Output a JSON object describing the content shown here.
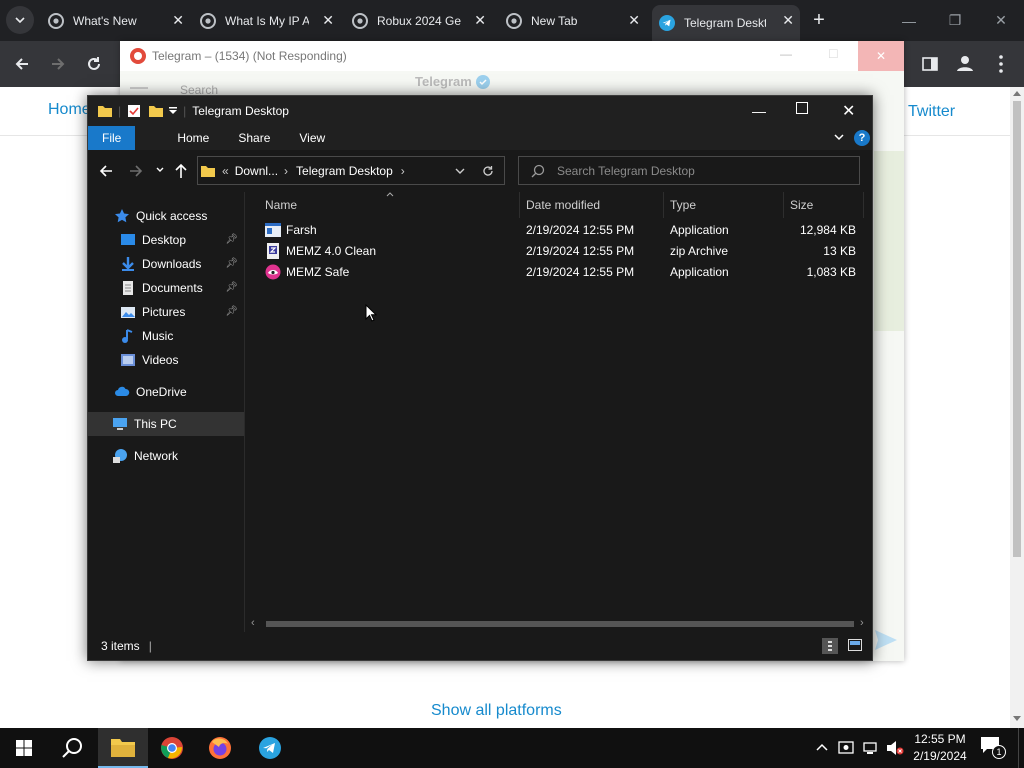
{
  "chrome": {
    "tabs": [
      {
        "title": "What's New"
      },
      {
        "title": "What Is My IP A"
      },
      {
        "title": "Robux 2024 Ge"
      },
      {
        "title": "New Tab"
      },
      {
        "title": "Telegram Deskt"
      }
    ],
    "new_tab": "+"
  },
  "webpage": {
    "nav_home": "Home",
    "nav_twitter": "Twitter",
    "show_all": "Show all platforms"
  },
  "telegram": {
    "window_title": "Telegram – (1534) (Not Responding)",
    "header_name": "Telegram",
    "search_placeholder": "Search"
  },
  "explorer": {
    "title": "Telegram Desktop",
    "ribbon": {
      "file": "File",
      "home": "Home",
      "share": "Share",
      "view": "View"
    },
    "breadcrumb": {
      "prefix": "«",
      "part1": "Downl...",
      "part2": "Telegram Desktop"
    },
    "search_placeholder": "Search Telegram Desktop",
    "nav": [
      {
        "label": "Quick access",
        "icon": "star-icon"
      },
      {
        "label": "Desktop",
        "icon": "desktop-icon"
      },
      {
        "label": "Downloads",
        "icon": "download-icon"
      },
      {
        "label": "Documents",
        "icon": "documents-icon"
      },
      {
        "label": "Pictures",
        "icon": "pictures-icon"
      },
      {
        "label": "Music",
        "icon": "music-icon"
      },
      {
        "label": "Videos",
        "icon": "videos-icon"
      },
      {
        "label": "OneDrive",
        "icon": "cloud-icon"
      },
      {
        "label": "This PC",
        "icon": "pc-icon"
      },
      {
        "label": "Network",
        "icon": "network-icon"
      }
    ],
    "columns": {
      "name": "Name",
      "date": "Date modified",
      "type": "Type",
      "size": "Size"
    },
    "files": [
      {
        "name": "Farsh",
        "date": "2/19/2024 12:55 PM",
        "type": "Application",
        "size": "12,984 KB",
        "icon": "app-icon"
      },
      {
        "name": "MEMZ 4.0 Clean",
        "date": "2/19/2024 12:55 PM",
        "type": "zip Archive",
        "size": "13 KB",
        "icon": "zip-icon"
      },
      {
        "name": "MEMZ Safe",
        "date": "2/19/2024 12:55 PM",
        "type": "Application",
        "size": "1,083 KB",
        "icon": "memz-icon"
      }
    ],
    "status": "3 items"
  },
  "taskbar": {
    "time": "12:55 PM",
    "date": "2/19/2024",
    "notification_count": "1"
  },
  "colors": {
    "accent": "#1979ca",
    "chrome_dark": "#202124",
    "explorer_bg": "#191919",
    "telegram_link": "#168acd"
  }
}
